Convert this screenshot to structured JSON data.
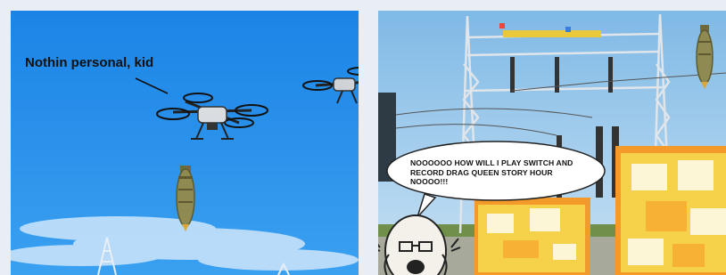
{
  "left_panel": {
    "caption": "Nothin personal, kid"
  },
  "right_panel": {
    "speech_bubble": "NOOOOOO HOW WILL I PLAY SWITCH AND RECORD DRAG QUEEN STORY HOUR NOOOO!!!"
  },
  "colors": {
    "page_background": "#e9eef5",
    "sky_left": "#1e88e8",
    "sky_right": "#8fc4ea",
    "explosion_yellow": "#f6d24a",
    "explosion_orange": "#f39a2a",
    "explosion_white": "#fdf6d6",
    "bomb_olive": "#8e8a52"
  },
  "icons": [
    "drone-icon",
    "bomb-icon",
    "explosion-icon",
    "crying-wojak-icon",
    "power-tower-icon"
  ]
}
